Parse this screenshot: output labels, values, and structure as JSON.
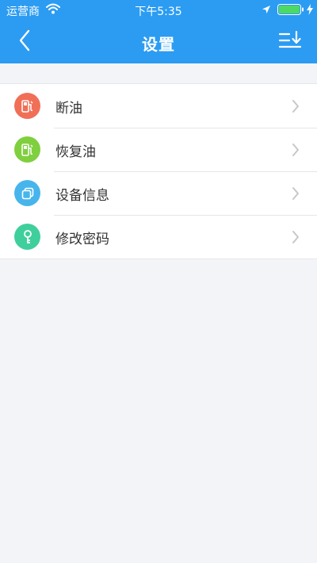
{
  "status_bar": {
    "carrier": "运营商",
    "time": "下午5:35",
    "icons": [
      "wifi-icon",
      "location-icon",
      "battery-icon",
      "charging-icon"
    ]
  },
  "nav": {
    "title": "设置",
    "back_icon": "chevron-left-icon",
    "right_icon": "sort-list-icon"
  },
  "colors": {
    "accent": "#2b9cf2",
    "background": "#f3f4f8",
    "battery": "#4cd964"
  },
  "settings": {
    "items": [
      {
        "label": "断油",
        "icon": "fuel-cut-icon",
        "color": "#f06f56"
      },
      {
        "label": "恢复油",
        "icon": "fuel-restore-icon",
        "color": "#7fcf3f"
      },
      {
        "label": "设备信息",
        "icon": "device-info-icon",
        "color": "#47b5ec"
      },
      {
        "label": "修改密码",
        "icon": "key-icon",
        "color": "#3fcf9c"
      }
    ]
  }
}
